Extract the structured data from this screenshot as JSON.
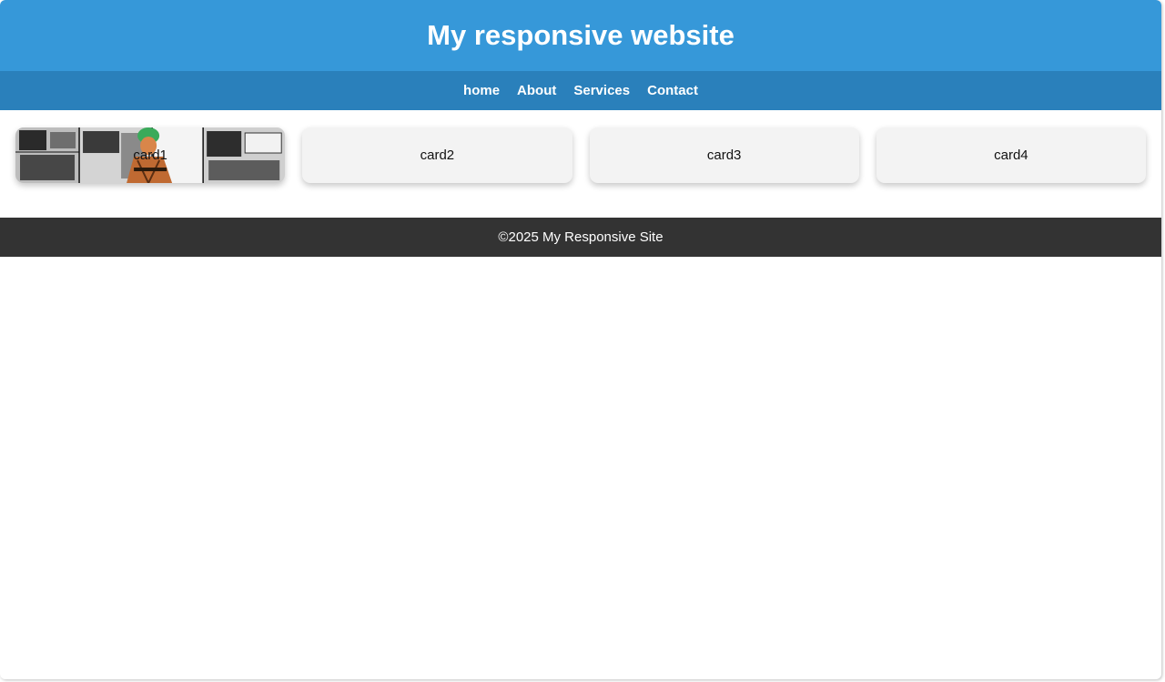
{
  "header": {
    "title": "My responsive website"
  },
  "nav": {
    "items": [
      {
        "label": "home"
      },
      {
        "label": "About"
      },
      {
        "label": "Services"
      },
      {
        "label": "Contact"
      }
    ]
  },
  "cards": [
    {
      "label": "card1",
      "background": "manga-collage-image"
    },
    {
      "label": "card2"
    },
    {
      "label": "card3"
    },
    {
      "label": "card4"
    }
  ],
  "footer": {
    "text": "©2025 My Responsive Site"
  },
  "colors": {
    "header_bg": "#3698d9",
    "nav_bg": "#2a80bb",
    "card_bg": "#f3f3f3",
    "footer_bg": "#333333"
  }
}
